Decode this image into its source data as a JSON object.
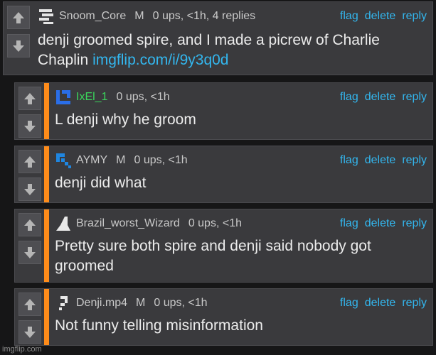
{
  "comments": [
    {
      "username": "Snoom_Core",
      "mod": "M",
      "stats": "0 ups, <1h, 4 replies",
      "text": "denji groomed spire, and I made a picrew of Charlie Chaplin ",
      "link": "imgflip.com/i/9y3q0d",
      "avatar": "stripes-avatar-icon"
    },
    {
      "username": "IxEl_1",
      "mod": "",
      "stats": "0 ups, <1h",
      "text": "L denji why he groom",
      "avatar": "blue-pixel-avatar-icon"
    },
    {
      "username": "AYMY",
      "mod": "M",
      "stats": "0 ups, <1h",
      "text": "denji did what",
      "avatar": "blue-arrow-avatar-icon"
    },
    {
      "username": "Brazil_worst_Wizard",
      "mod": "",
      "stats": "0 ups, <1h",
      "text": "Pretty sure both spire and denji said nobody got groomed",
      "avatar": "wizard-hat-avatar-icon"
    },
    {
      "username": "Denji.mp4",
      "mod": "M",
      "stats": "0 ups, <1h",
      "text": "Not funny telling misinformation",
      "avatar": "pixel-avatar-icon"
    }
  ],
  "actions": {
    "flag": "flag",
    "delete": "delete",
    "reply": "reply"
  },
  "watermark": "imgflip.com",
  "colors": {
    "accent_link": "#33b7ef",
    "reply_bar": "#ff8c1a",
    "username_green": "#3bd65c"
  }
}
